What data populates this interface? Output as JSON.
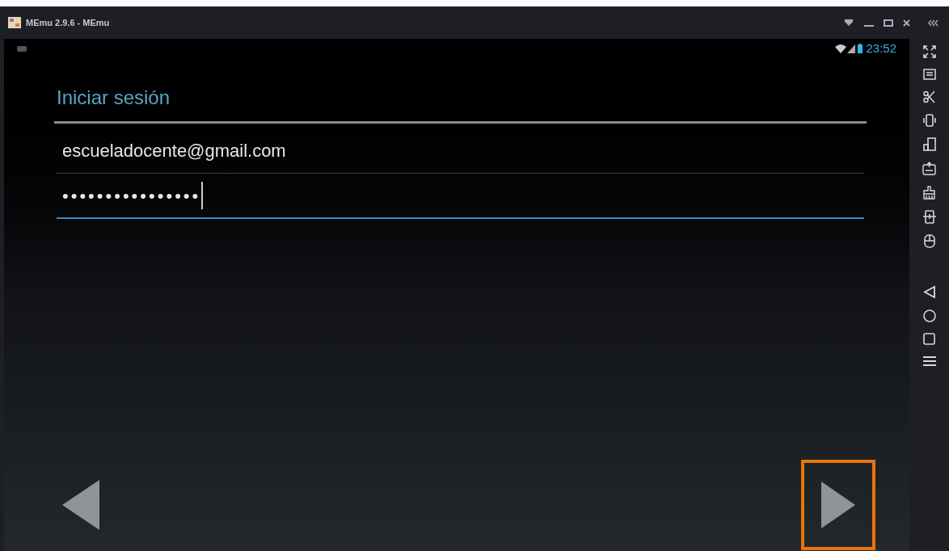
{
  "window": {
    "title": "MEmu 2.9.6 - MEmu"
  },
  "status_bar": {
    "time": "23:52"
  },
  "login": {
    "title": "Iniciar sesión",
    "fields": [
      {
        "kind": "email",
        "value": "escueladocente@gmail.com",
        "focused": false
      },
      {
        "kind": "password",
        "value": "••••••••••••••••",
        "focused": true
      }
    ]
  },
  "navigation": {
    "back_highlighted": false,
    "next_highlighted": true
  }
}
